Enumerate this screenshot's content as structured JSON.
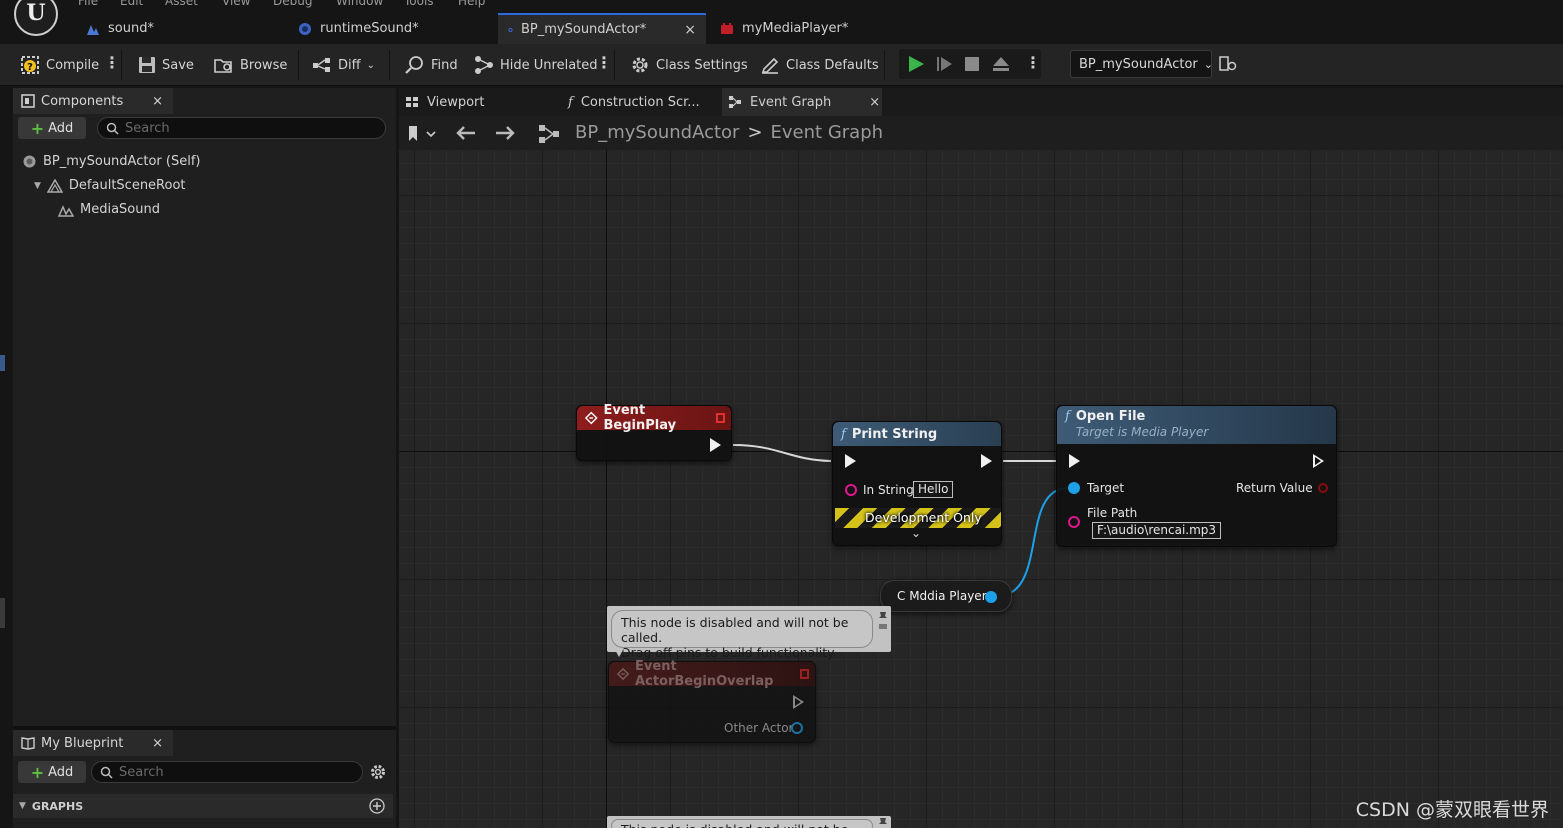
{
  "menu": [
    "File",
    "Edit",
    "Asset",
    "View",
    "Debug",
    "Window",
    "Tools",
    "Help"
  ],
  "doc_tabs": [
    {
      "label": "sound*"
    },
    {
      "label": "runtimeSound*"
    },
    {
      "label": "BP_mySoundActor*",
      "close": "×"
    },
    {
      "label": "myMediaPlayer*"
    }
  ],
  "toolbar": {
    "compile": "Compile",
    "save": "Save",
    "browse": "Browse",
    "diff": "Diff",
    "find": "Find",
    "hide_unrelated": "Hide Unrelated",
    "class_settings": "Class Settings",
    "class_defaults": "Class Defaults",
    "debug_object": "BP_mySoundActor"
  },
  "components_panel": {
    "title": "Components",
    "close": "×",
    "add": "Add",
    "search_placeholder": "Search",
    "tree": [
      "BP_mySoundActor (Self)",
      "DefaultSceneRoot",
      "MediaSound"
    ]
  },
  "my_blueprint_panel": {
    "title": "My Blueprint",
    "close": "×",
    "add": "Add",
    "search_placeholder": "Search",
    "section": "GRAPHS"
  },
  "graph_tabs": [
    {
      "label": "Viewport"
    },
    {
      "label": "Construction Scr..."
    },
    {
      "label": "Event Graph",
      "close": "×"
    }
  ],
  "breadcrumb": {
    "root": "BP_mySoundActor",
    "sep": ">",
    "current": "Event Graph"
  },
  "nodes": {
    "begin_play": {
      "title": "Event BeginPlay"
    },
    "print_string": {
      "title": "Print String",
      "in_string_label": "In String",
      "in_string_value": "Hello",
      "dev_only": "Development Only"
    },
    "open_file": {
      "title": "Open File",
      "subtitle": "Target is Media Player",
      "target": "Target",
      "return_value": "Return Value",
      "file_path_label": "File Path",
      "file_path_value": "F:\\audio\\rencai.mp3"
    },
    "media_var": {
      "label": "C Mddia Player"
    },
    "overlap": {
      "title": "Event ActorBeginOverlap",
      "other_actor": "Other Actor"
    }
  },
  "comment_disabled": "This node is disabled and will not be called.\nDrag off pins to build functionality.",
  "comment_disabled_partial": "This node is disabled and will not be called.",
  "watermark": "CSDN @蒙双眼看世界",
  "colors": {
    "accent": "#2b6ad8",
    "event_red": "#8b1c1c",
    "function_blue": "#3b5a78",
    "object_pin": "#1ea0e8",
    "string_pin": "#e0168f"
  }
}
